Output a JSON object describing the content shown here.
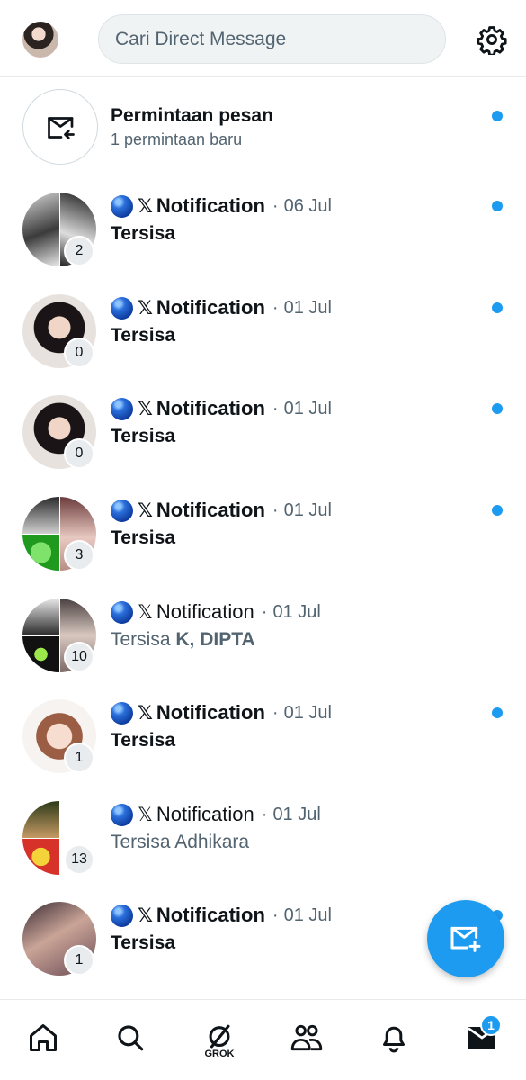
{
  "header": {
    "search_placeholder": "Cari Direct Message"
  },
  "requests": {
    "title": "Permintaan pesan",
    "subtitle": "1 permintaan baru"
  },
  "conversations": [
    {
      "name": "Notification",
      "x": "𝕏",
      "sep": "·",
      "date": "06 Jul",
      "preview": "Tersisa",
      "preview_bold": "",
      "count": "2",
      "unread": true
    },
    {
      "name": "Notification",
      "x": "𝕏",
      "sep": "·",
      "date": "01 Jul",
      "preview": "Tersisa",
      "preview_bold": "",
      "count": "0",
      "unread": true
    },
    {
      "name": "Notification",
      "x": "𝕏",
      "sep": "·",
      "date": "01 Jul",
      "preview": "Tersisa",
      "preview_bold": "",
      "count": "0",
      "unread": true
    },
    {
      "name": "Notification",
      "x": "𝕏",
      "sep": "·",
      "date": "01 Jul",
      "preview": "Tersisa",
      "preview_bold": "",
      "count": "3",
      "unread": true
    },
    {
      "name": "Notification",
      "x": "𝕏",
      "sep": "·",
      "date": "01 Jul",
      "preview": "Tersisa ",
      "preview_bold": "K, DIPTA",
      "count": "10",
      "unread": false
    },
    {
      "name": "Notification",
      "x": "𝕏",
      "sep": "·",
      "date": "01 Jul",
      "preview": "Tersisa",
      "preview_bold": "",
      "count": "1",
      "unread": true
    },
    {
      "name": "Notification",
      "x": "𝕏",
      "sep": "·",
      "date": "01 Jul",
      "preview": "Tersisa Adhikara",
      "preview_bold": "",
      "count": "13",
      "unread": false
    },
    {
      "name": "Notification",
      "x": "𝕏",
      "sep": "·",
      "date": "01 Jul",
      "preview": "Tersisa",
      "preview_bold": "",
      "count": "1",
      "unread": true
    }
  ],
  "nav": {
    "grok_label": "GROK",
    "messages_badge": "1"
  },
  "colors": {
    "accent": "#1d9bf0",
    "text": "#0f1419",
    "muted": "#536471"
  },
  "icons": [
    "settings-gear-icon",
    "message-request-icon",
    "new-message-icon",
    "home-icon",
    "search-icon",
    "grok-icon",
    "communities-icon",
    "notifications-bell-icon",
    "messages-icon"
  ]
}
